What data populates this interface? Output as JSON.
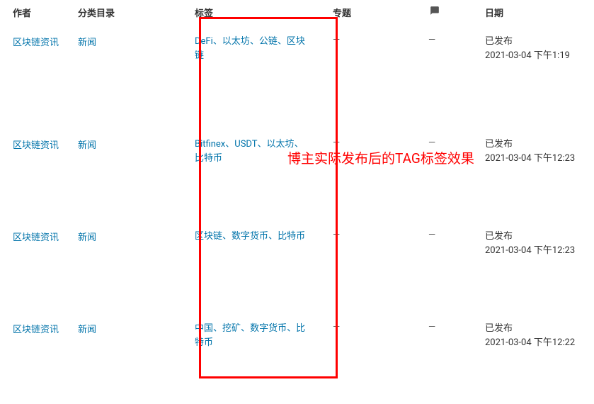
{
  "headers": {
    "author": "作者",
    "category": "分类目录",
    "tags": "标签",
    "topic": "专题",
    "date": "日期"
  },
  "rows": [
    {
      "author": "区块链资讯",
      "category": "新闻",
      "tags": [
        "DeFi",
        "以太坊",
        "公链",
        "区块链"
      ],
      "topic": "—",
      "comment": "—",
      "status": "已发布",
      "datetime": "2021-03-04 下午1:19"
    },
    {
      "author": "区块链资讯",
      "category": "新闻",
      "tags": [
        "Bitfinex",
        "USDT",
        "以太坊",
        "比特币"
      ],
      "topic": "—",
      "comment": "—",
      "status": "已发布",
      "datetime": "2021-03-04 下午12:23"
    },
    {
      "author": "区块链资讯",
      "category": "新闻",
      "tags": [
        "区块链",
        "数字货币",
        "比特币"
      ],
      "topic": "—",
      "comment": "—",
      "status": "已发布",
      "datetime": "2021-03-04 下午12:23"
    },
    {
      "author": "区块链资讯",
      "category": "新闻",
      "tags": [
        "中国",
        "挖矿",
        "数字货币",
        "比特币"
      ],
      "topic": "—",
      "comment": "—",
      "status": "已发布",
      "datetime": "2021-03-04 下午12:22"
    }
  ],
  "annotation": "博主实际发布后的TAG标签效果",
  "separator": "、"
}
